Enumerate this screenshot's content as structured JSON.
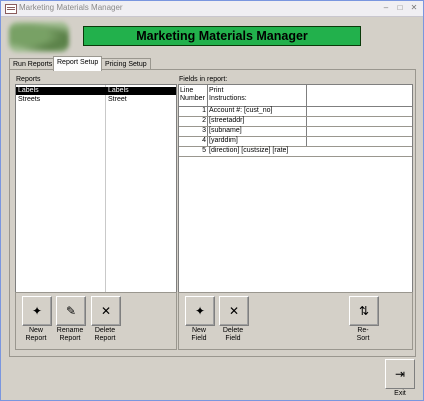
{
  "window": {
    "title": "Marketing Materials Manager",
    "minimize_icon": "minimize-icon",
    "maximize_icon": "maximize-icon",
    "close_icon": "close-icon"
  },
  "header": {
    "banner": "Marketing Materials Manager"
  },
  "tabs": [
    {
      "label": "Run Reports"
    },
    {
      "label": "Report Setup"
    },
    {
      "label": "Pricing Setup"
    }
  ],
  "active_tab": "Report Setup",
  "reports": {
    "label": "Reports",
    "rows": [
      {
        "name": "Labels",
        "type": "Labels"
      },
      {
        "name": "Streets",
        "type": "Street"
      }
    ]
  },
  "fields": {
    "label": "Fields in report:",
    "col_line": "Line Number",
    "col_line_1": "Line",
    "col_line_2": "Number",
    "col_print_1": "Print",
    "col_print_2": "Instructions:",
    "rows": [
      {
        "num": "1",
        "text": "Account #: [cust_no]"
      },
      {
        "num": "2",
        "text": "[streetaddr]"
      },
      {
        "num": "3",
        "text": "[subname]"
      },
      {
        "num": "4",
        "text": "[yarddim]"
      },
      {
        "num": "5",
        "text": "[direction] [custsize] [rate]"
      }
    ]
  },
  "buttons": {
    "new_report_1": "New",
    "new_report_2": "Report",
    "rename_report_1": "Rename",
    "rename_report_2": "Report",
    "delete_report_1": "Delete",
    "delete_report_2": "Report",
    "new_field_1": "New",
    "new_field_2": "Field",
    "delete_field_1": "Delete",
    "delete_field_2": "Field",
    "resort_1": "Re-",
    "resort_2": "Sort",
    "exit": "Exit"
  },
  "colors": {
    "banner": "#22b14c",
    "selection": "#000000",
    "face": "#d4d0c8"
  }
}
